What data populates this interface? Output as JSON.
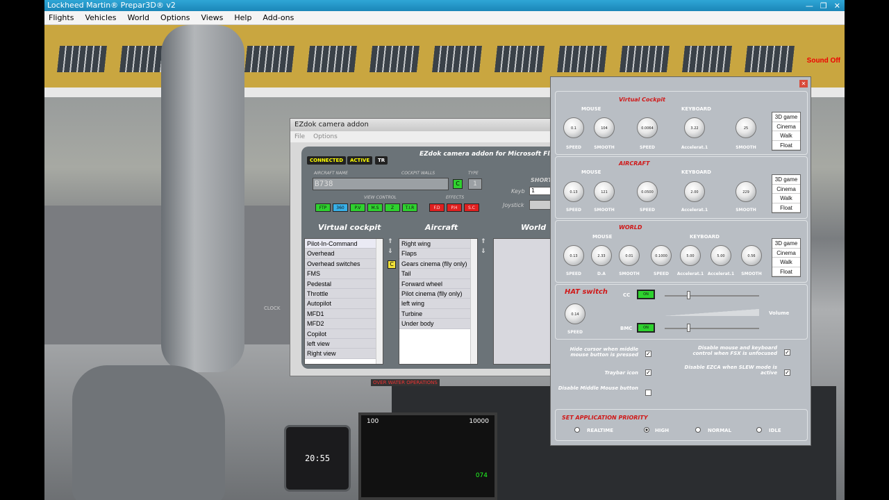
{
  "window": {
    "title": "Lockheed Martin® Prepar3D® v2",
    "controls": [
      "—",
      "❐",
      "✕"
    ]
  },
  "menu": [
    "Flights",
    "Vehicles",
    "World",
    "Options",
    "Views",
    "Help",
    "Add-ons"
  ],
  "sim": {
    "sound_status": "Sound Off",
    "pfd_alt": "10000",
    "pfd_spd": "100",
    "clock": "20:55",
    "overwater": "OVER WATER OPERATIONS",
    "pfd_small": "074",
    "warn1": "CLOCK"
  },
  "ezdok": {
    "title": "EZdok camera addon",
    "menu": [
      "File",
      "Options"
    ],
    "badges": {
      "connected": "CONNECTED",
      "active": "ACTIVE",
      "tr": "TR"
    },
    "heading": "EZdok camera addon for Microsoft Flight Sim",
    "aircraft_name_label": "AIRCRAFT NAME",
    "cockpit_walls_label": "COCKPIT WALLS",
    "type_label": "TYPE",
    "aircraft_name": "B738",
    "cockpit_walls": "C",
    "type": "1",
    "shortcut_label": "SHORT",
    "keyb_label": "Keyb",
    "keyb_value": "1",
    "joystick_label": "Joystick",
    "view_control_label": "VIEW CONTROL",
    "effects_label": "EFFECTS",
    "view_buttons": [
      "FTP",
      "360",
      "P.V",
      "M.S",
      "Z",
      "T.I.R"
    ],
    "effect_buttons": [
      "F.D",
      "P.H",
      "S.C"
    ],
    "sections": {
      "virtual_cockpit": "Virtual cockpit",
      "aircraft": "Aircraft",
      "world": "World"
    },
    "vc_list": [
      "Pilot-In-Command",
      "Overhead",
      "Overhead switches",
      "FMS",
      "Pedestal",
      "Throttle",
      "Autopilot",
      "MFD1",
      "MFD2",
      "Copilot",
      "left view",
      "Right view"
    ],
    "ac_list": [
      "Right wing",
      "Flaps",
      "Gears cinema (flly only)",
      "Tail",
      "Forward wheel",
      "Pilot cinema (flly only)",
      "left wing",
      "Turbine",
      "Under body"
    ],
    "mid_btn": "C"
  },
  "settings": {
    "virtual_cockpit": "Virtual Cockpit",
    "aircraft": "AIRCRAFT",
    "world": "WORLD",
    "mouse": "MOUSE",
    "keyboard": "KEYBOARD",
    "vc_knobs": [
      {
        "v": "0.1",
        "l": "SPEED"
      },
      {
        "v": "104",
        "l": "SMOOTH"
      },
      {
        "v": "0.0064",
        "l": "SPEED"
      },
      {
        "v": "3.22",
        "l": "Accelerat.1"
      },
      {
        "v": "25",
        "l": "SMOOTH"
      }
    ],
    "ac_knobs": [
      {
        "v": "0.13",
        "l": "SPEED"
      },
      {
        "v": "121",
        "l": "SMOOTH"
      },
      {
        "v": "0.0500",
        "l": "SPEED"
      },
      {
        "v": "2.00",
        "l": "Accelerat.1"
      },
      {
        "v": "229",
        "l": "SMOOTH"
      }
    ],
    "w_knobs": [
      {
        "v": "0.13",
        "l": "SPEED"
      },
      {
        "v": "2.33",
        "l": "D.A"
      },
      {
        "v": "0.01",
        "l": "SMOOTH"
      },
      {
        "v": "0.1000",
        "l": "SPEED"
      },
      {
        "v": "5.00",
        "l": "Accelerat.1"
      },
      {
        "v": "5.00",
        "l": "Accelerat.1"
      },
      {
        "v": "0.56",
        "l": "SMOOTH"
      }
    ],
    "modes": [
      "3D game",
      "Cinema",
      "Walk",
      "Float"
    ],
    "hat_switch": "HAT switch",
    "hat_knob": {
      "v": "0.14",
      "l": "SPEED"
    },
    "cc_label": "CC",
    "bmc_label": "BMC",
    "on_label": "ON",
    "volume_label": "Volume",
    "opts": {
      "hide_cursor": "Hide cursor when middle mouse button is pressed",
      "disable_mouse": "Disable mouse and keyboard control when FSX is unfocused",
      "traybar": "Traybar icon",
      "disable_ezca": "Disable EZCA when SLEW mode is active",
      "disable_middle": "Disable Middle Mouse button"
    },
    "priority_title": "SET APPLICATION PRIORITY",
    "priority": [
      "REALTIME",
      "HIGH",
      "NORMAL",
      "IDLE"
    ]
  }
}
